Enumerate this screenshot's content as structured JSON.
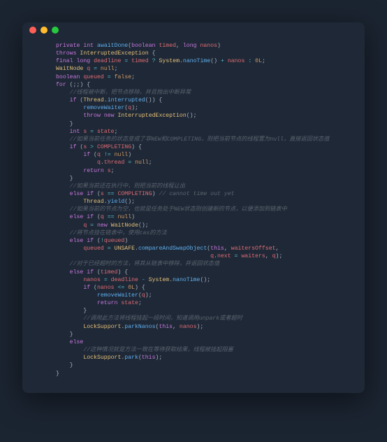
{
  "window": {
    "traffic_lights": [
      "close",
      "minimize",
      "maximize"
    ]
  },
  "code": {
    "lines": [
      [
        [
          "kw",
          "private"
        ],
        [
          "pn",
          " "
        ],
        [
          "kw",
          "int"
        ],
        [
          "pn",
          " "
        ],
        [
          "fn",
          "awaitDone"
        ],
        [
          "pn",
          "("
        ],
        [
          "kw",
          "boolean"
        ],
        [
          "pn",
          " "
        ],
        [
          "var",
          "timed"
        ],
        [
          "pn",
          ", "
        ],
        [
          "kw",
          "long"
        ],
        [
          "pn",
          " "
        ],
        [
          "var",
          "nanos"
        ],
        [
          "pn",
          ")"
        ]
      ],
      [
        [
          "kw",
          "throws"
        ],
        [
          "pn",
          " "
        ],
        [
          "ty",
          "InterruptedException"
        ],
        [
          "pn",
          " {"
        ]
      ],
      [
        [
          "kw",
          "final"
        ],
        [
          "pn",
          " "
        ],
        [
          "kw",
          "long"
        ],
        [
          "pn",
          " "
        ],
        [
          "var",
          "deadline"
        ],
        [
          "pn",
          " "
        ],
        [
          "op",
          "="
        ],
        [
          "pn",
          " "
        ],
        [
          "var",
          "timed"
        ],
        [
          "pn",
          " "
        ],
        [
          "op",
          "?"
        ],
        [
          "pn",
          " "
        ],
        [
          "ty",
          "System"
        ],
        [
          "pn",
          "."
        ],
        [
          "fn",
          "nanoTime"
        ],
        [
          "pn",
          "() "
        ],
        [
          "op",
          "+"
        ],
        [
          "pn",
          " "
        ],
        [
          "var",
          "nanos"
        ],
        [
          "pn",
          " "
        ],
        [
          "op",
          ":"
        ],
        [
          "pn",
          " "
        ],
        [
          "lit",
          "0L"
        ],
        [
          "pn",
          ";"
        ]
      ],
      [
        [
          "ty",
          "WaitNode"
        ],
        [
          "pn",
          " "
        ],
        [
          "var",
          "q"
        ],
        [
          "pn",
          " "
        ],
        [
          "op",
          "="
        ],
        [
          "pn",
          " "
        ],
        [
          "lit",
          "null"
        ],
        [
          "pn",
          ";"
        ]
      ],
      [
        [
          "kw",
          "boolean"
        ],
        [
          "pn",
          " "
        ],
        [
          "var",
          "queued"
        ],
        [
          "pn",
          " "
        ],
        [
          "op",
          "="
        ],
        [
          "pn",
          " "
        ],
        [
          "lit",
          "false"
        ],
        [
          "pn",
          ";"
        ]
      ],
      [
        [
          "kw",
          "for"
        ],
        [
          "pn",
          " (;;) {"
        ]
      ],
      [
        [
          "pn",
          "    "
        ],
        [
          "cmt",
          "//线程被中断，把节点移除，并且抛出中断异常"
        ]
      ],
      [
        [
          "pn",
          "    "
        ],
        [
          "kw",
          "if"
        ],
        [
          "pn",
          " ("
        ],
        [
          "ty",
          "Thread"
        ],
        [
          "pn",
          "."
        ],
        [
          "fn",
          "interrupted"
        ],
        [
          "pn",
          "()) {"
        ]
      ],
      [
        [
          "pn",
          "        "
        ],
        [
          "fn",
          "removeWaiter"
        ],
        [
          "pn",
          "("
        ],
        [
          "var",
          "q"
        ],
        [
          "pn",
          ");"
        ]
      ],
      [
        [
          "pn",
          "        "
        ],
        [
          "kw",
          "throw"
        ],
        [
          "pn",
          " "
        ],
        [
          "kw",
          "new"
        ],
        [
          "pn",
          " "
        ],
        [
          "ty",
          "InterruptedException"
        ],
        [
          "pn",
          "();"
        ]
      ],
      [
        [
          "pn",
          "    }"
        ]
      ],
      [
        [
          "pn",
          "    "
        ],
        [
          "kw",
          "int"
        ],
        [
          "pn",
          " "
        ],
        [
          "var",
          "s"
        ],
        [
          "pn",
          " "
        ],
        [
          "op",
          "="
        ],
        [
          "pn",
          " "
        ],
        [
          "var",
          "state"
        ],
        [
          "pn",
          ";"
        ]
      ],
      [
        [
          "pn",
          "    "
        ],
        [
          "cmt",
          "//如果当前任务的状态变成了非NEW和COMPLETING，则把当前节点的线程置为null，直接返回状态值"
        ]
      ],
      [
        [
          "pn",
          "    "
        ],
        [
          "kw",
          "if"
        ],
        [
          "pn",
          " ("
        ],
        [
          "var",
          "s"
        ],
        [
          "pn",
          " "
        ],
        [
          "op",
          ">"
        ],
        [
          "pn",
          " "
        ],
        [
          "var",
          "COMPLETING"
        ],
        [
          "pn",
          ") {"
        ]
      ],
      [
        [
          "pn",
          "        "
        ],
        [
          "kw",
          "if"
        ],
        [
          "pn",
          " ("
        ],
        [
          "var",
          "q"
        ],
        [
          "pn",
          " "
        ],
        [
          "op",
          "!="
        ],
        [
          "pn",
          " "
        ],
        [
          "lit",
          "null"
        ],
        [
          "pn",
          ")"
        ]
      ],
      [
        [
          "pn",
          "            "
        ],
        [
          "var",
          "q"
        ],
        [
          "pn",
          "."
        ],
        [
          "var",
          "thread"
        ],
        [
          "pn",
          " "
        ],
        [
          "op",
          "="
        ],
        [
          "pn",
          " "
        ],
        [
          "lit",
          "null"
        ],
        [
          "pn",
          ";"
        ]
      ],
      [
        [
          "pn",
          "        "
        ],
        [
          "kw",
          "return"
        ],
        [
          "pn",
          " "
        ],
        [
          "var",
          "s"
        ],
        [
          "pn",
          ";"
        ]
      ],
      [
        [
          "pn",
          "    }"
        ]
      ],
      [
        [
          "pn",
          "    "
        ],
        [
          "cmt",
          "//如果当前还在执行中，则把当前的线程让出"
        ]
      ],
      [
        [
          "pn",
          "    "
        ],
        [
          "kw",
          "else"
        ],
        [
          "pn",
          " "
        ],
        [
          "kw",
          "if"
        ],
        [
          "pn",
          " ("
        ],
        [
          "var",
          "s"
        ],
        [
          "pn",
          " "
        ],
        [
          "op",
          "=="
        ],
        [
          "pn",
          " "
        ],
        [
          "var",
          "COMPLETING"
        ],
        [
          "pn",
          ") "
        ],
        [
          "cmt",
          "// cannot time out yet"
        ]
      ],
      [
        [
          "pn",
          "        "
        ],
        [
          "ty",
          "Thread"
        ],
        [
          "pn",
          "."
        ],
        [
          "fn",
          "yield"
        ],
        [
          "pn",
          "();"
        ]
      ],
      [
        [
          "pn",
          "    "
        ],
        [
          "cmt",
          "//如果当前的节点为空，也就是任务处于NEW状态则创建新的节点，以便添加到链表中"
        ]
      ],
      [
        [
          "pn",
          "    "
        ],
        [
          "kw",
          "else"
        ],
        [
          "pn",
          " "
        ],
        [
          "kw",
          "if"
        ],
        [
          "pn",
          " ("
        ],
        [
          "var",
          "q"
        ],
        [
          "pn",
          " "
        ],
        [
          "op",
          "=="
        ],
        [
          "pn",
          " "
        ],
        [
          "lit",
          "null"
        ],
        [
          "pn",
          ")"
        ]
      ],
      [
        [
          "pn",
          "        "
        ],
        [
          "var",
          "q"
        ],
        [
          "pn",
          " "
        ],
        [
          "op",
          "="
        ],
        [
          "pn",
          " "
        ],
        [
          "kw",
          "new"
        ],
        [
          "pn",
          " "
        ],
        [
          "ty",
          "WaitNode"
        ],
        [
          "pn",
          "();"
        ]
      ],
      [
        [
          "pn",
          "    "
        ],
        [
          "cmt",
          "//将节点挂在链表中，使用cas的方法"
        ]
      ],
      [
        [
          "pn",
          "    "
        ],
        [
          "kw",
          "else"
        ],
        [
          "pn",
          " "
        ],
        [
          "kw",
          "if"
        ],
        [
          "pn",
          " ("
        ],
        [
          "op",
          "!"
        ],
        [
          "var",
          "queued"
        ],
        [
          "pn",
          ")"
        ]
      ],
      [
        [
          "pn",
          "        "
        ],
        [
          "var",
          "queued"
        ],
        [
          "pn",
          " "
        ],
        [
          "op",
          "="
        ],
        [
          "pn",
          " "
        ],
        [
          "ty",
          "UNSAFE"
        ],
        [
          "pn",
          "."
        ],
        [
          "fn",
          "compareAndSwapObject"
        ],
        [
          "pn",
          "("
        ],
        [
          "kw",
          "this"
        ],
        [
          "pn",
          ", "
        ],
        [
          "var",
          "waitersOffset"
        ],
        [
          "pn",
          ","
        ]
      ],
      [
        [
          "pn",
          "                                             "
        ],
        [
          "var",
          "q"
        ],
        [
          "pn",
          "."
        ],
        [
          "var",
          "next"
        ],
        [
          "pn",
          " "
        ],
        [
          "op",
          "="
        ],
        [
          "pn",
          " "
        ],
        [
          "var",
          "waiters"
        ],
        [
          "pn",
          ", "
        ],
        [
          "var",
          "q"
        ],
        [
          "pn",
          ");"
        ]
      ],
      [
        [
          "pn",
          "    "
        ],
        [
          "cmt",
          "//对于已经超时的方法，将其从链表中移除，并返回状态值"
        ]
      ],
      [
        [
          "pn",
          "    "
        ],
        [
          "kw",
          "else"
        ],
        [
          "pn",
          " "
        ],
        [
          "kw",
          "if"
        ],
        [
          "pn",
          " ("
        ],
        [
          "var",
          "timed"
        ],
        [
          "pn",
          ") {"
        ]
      ],
      [
        [
          "pn",
          "        "
        ],
        [
          "var",
          "nanos"
        ],
        [
          "pn",
          " "
        ],
        [
          "op",
          "="
        ],
        [
          "pn",
          " "
        ],
        [
          "var",
          "deadline"
        ],
        [
          "pn",
          " "
        ],
        [
          "op",
          "-"
        ],
        [
          "pn",
          " "
        ],
        [
          "ty",
          "System"
        ],
        [
          "pn",
          "."
        ],
        [
          "fn",
          "nanoTime"
        ],
        [
          "pn",
          "();"
        ]
      ],
      [
        [
          "pn",
          "        "
        ],
        [
          "kw",
          "if"
        ],
        [
          "pn",
          " ("
        ],
        [
          "var",
          "nanos"
        ],
        [
          "pn",
          " "
        ],
        [
          "op",
          "<="
        ],
        [
          "pn",
          " "
        ],
        [
          "lit",
          "0L"
        ],
        [
          "pn",
          ") {"
        ]
      ],
      [
        [
          "pn",
          "            "
        ],
        [
          "fn",
          "removeWaiter"
        ],
        [
          "pn",
          "("
        ],
        [
          "var",
          "q"
        ],
        [
          "pn",
          ");"
        ]
      ],
      [
        [
          "pn",
          "            "
        ],
        [
          "kw",
          "return"
        ],
        [
          "pn",
          " "
        ],
        [
          "var",
          "state"
        ],
        [
          "pn",
          ";"
        ]
      ],
      [
        [
          "pn",
          "        }"
        ]
      ],
      [
        [
          "pn",
          "        "
        ],
        [
          "cmt",
          "//调用此方法将线程挂起一段时间，知道调用unpark或者超时"
        ]
      ],
      [
        [
          "pn",
          "        "
        ],
        [
          "ty",
          "LockSupport"
        ],
        [
          "pn",
          "."
        ],
        [
          "fn",
          "parkNanos"
        ],
        [
          "pn",
          "("
        ],
        [
          "kw",
          "this"
        ],
        [
          "pn",
          ", "
        ],
        [
          "var",
          "nanos"
        ],
        [
          "pn",
          ");"
        ]
      ],
      [
        [
          "pn",
          "    }"
        ]
      ],
      [
        [
          "pn",
          "    "
        ],
        [
          "kw",
          "else"
        ]
      ],
      [
        [
          "pn",
          "        "
        ],
        [
          "cmt",
          "//这种情况就是方法一致在等待获取结果，线程被挂起阻塞"
        ]
      ],
      [
        [
          "pn",
          "        "
        ],
        [
          "ty",
          "LockSupport"
        ],
        [
          "pn",
          "."
        ],
        [
          "fn",
          "park"
        ],
        [
          "pn",
          "("
        ],
        [
          "kw",
          "this"
        ],
        [
          "pn",
          ");"
        ]
      ],
      [
        [
          "pn",
          "    }"
        ]
      ],
      [
        [
          "pn",
          "}"
        ]
      ]
    ]
  }
}
